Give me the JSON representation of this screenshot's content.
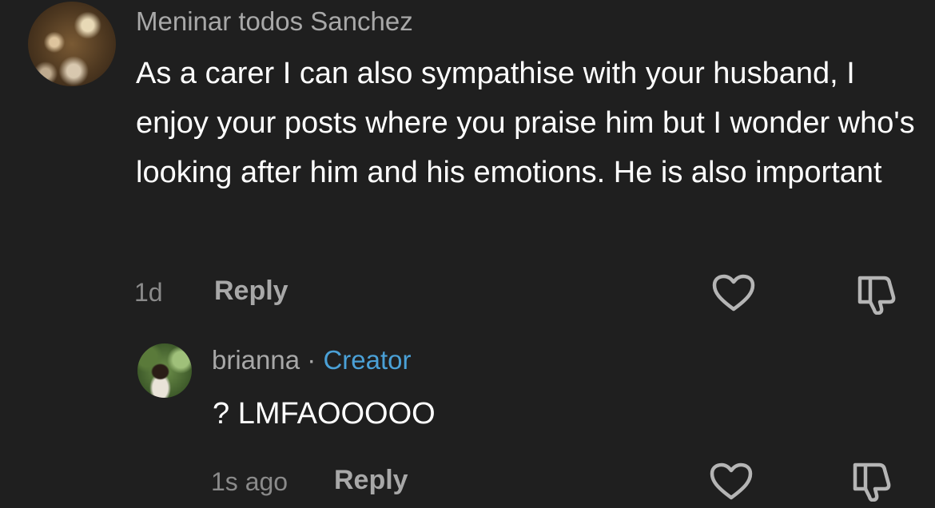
{
  "comment": {
    "username": "Meninar todos Sanchez",
    "text": "As a carer I can also sympathise with your husband, I enjoy your posts where you praise him but I wonder who's looking after him and his emotions. He is also important",
    "time": "1d",
    "reply_label": "Reply",
    "icons": {
      "like": "heart-icon",
      "dislike": "thumbs-down-icon"
    }
  },
  "reply": {
    "username": "brianna",
    "separator": "·",
    "badge": "Creator",
    "text": "? LMFAOOOOO",
    "time": "1s ago",
    "reply_label": "Reply",
    "icons": {
      "like": "heart-icon",
      "dislike": "thumbs-down-icon"
    }
  },
  "colors": {
    "background": "#1f1f1f",
    "creator_badge": "#4aa0d6",
    "text": "#ffffff",
    "muted": "#a8a8a8"
  }
}
